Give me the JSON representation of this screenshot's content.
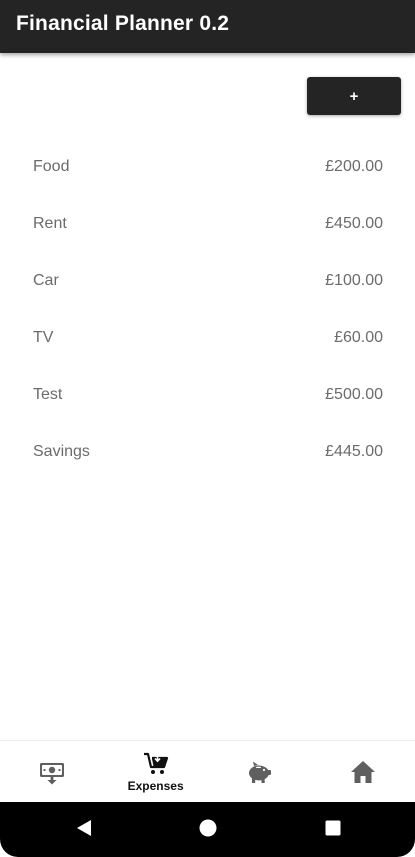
{
  "app_bar": {
    "title": "Financial Planner 0.2"
  },
  "add_button": {
    "label": "+"
  },
  "expenses": [
    {
      "name": "Food",
      "amount": "£200.00"
    },
    {
      "name": "Rent",
      "amount": "£450.00"
    },
    {
      "name": "Car",
      "amount": "£100.00"
    },
    {
      "name": "TV",
      "amount": "£60.00"
    },
    {
      "name": "Test",
      "amount": "£500.00"
    },
    {
      "name": "Savings",
      "amount": "£445.00"
    }
  ],
  "bottom_nav": {
    "items": [
      {
        "icon": "income-icon",
        "label": "",
        "active": false
      },
      {
        "icon": "cart-icon",
        "label": "Expenses",
        "active": true
      },
      {
        "icon": "piggy-bank-icon",
        "label": "",
        "active": false
      },
      {
        "icon": "home-icon",
        "label": "",
        "active": false
      }
    ]
  },
  "system_nav": {
    "buttons": [
      "back-icon",
      "home-circle-icon",
      "recents-icon"
    ]
  },
  "colors": {
    "app_bar": "#242424",
    "text_secondary": "#6b6b6b",
    "icon_inactive": "#5f5f5f",
    "icon_active": "#111111"
  }
}
